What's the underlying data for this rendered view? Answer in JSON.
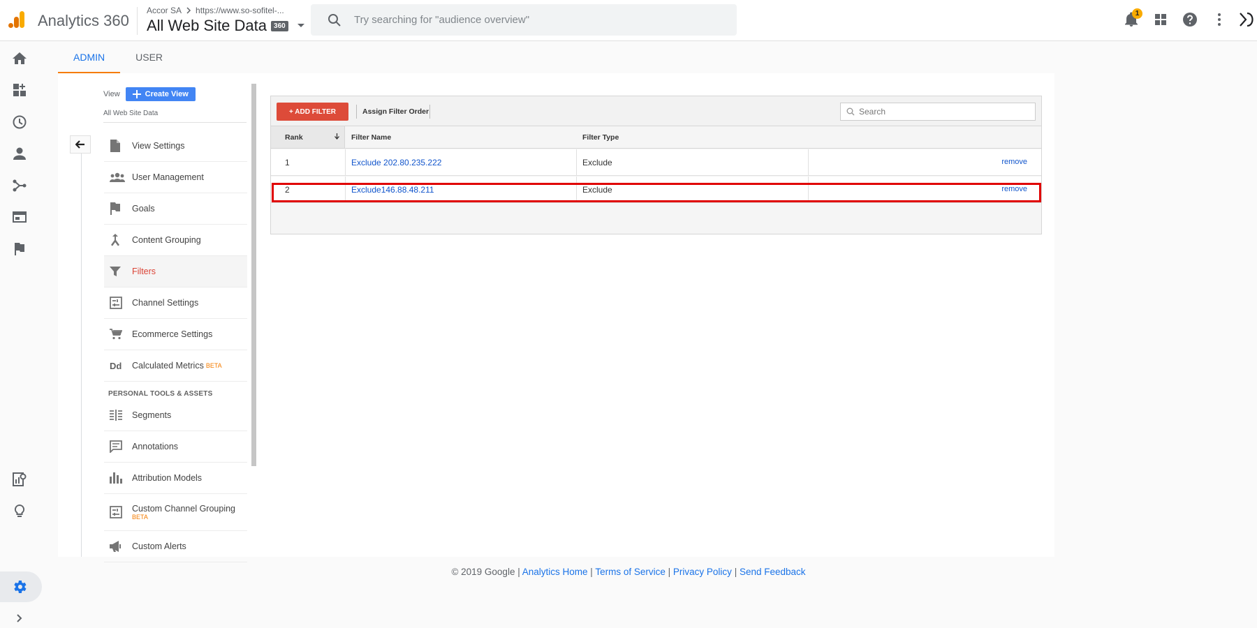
{
  "header": {
    "app_title": "Analytics 360",
    "account": "Accor SA",
    "property": "https://www.so-sofitel-...",
    "view_title": "All Web Site Data",
    "badge": "360",
    "search_placeholder": "Try searching for \"audience overview\"",
    "notification_count": "1"
  },
  "tabs": [
    {
      "label": "ADMIN",
      "active": true
    },
    {
      "label": "USER",
      "active": false
    }
  ],
  "view_column": {
    "label": "View",
    "create_button": "Create View",
    "current_view": "All Web Site Data",
    "menu": [
      {
        "label": "View Settings",
        "icon": "document-icon"
      },
      {
        "label": "User Management",
        "icon": "people-icon"
      },
      {
        "label": "Goals",
        "icon": "flag-icon"
      },
      {
        "label": "Content Grouping",
        "icon": "merge-icon"
      },
      {
        "label": "Filters",
        "icon": "funnel-icon",
        "active": true
      },
      {
        "label": "Channel Settings",
        "icon": "channel-icon"
      },
      {
        "label": "Ecommerce Settings",
        "icon": "cart-icon"
      },
      {
        "label": "Calculated Metrics",
        "icon": "dd-icon",
        "badge": "BETA"
      }
    ],
    "section_title": "PERSONAL TOOLS & ASSETS",
    "personal_menu": [
      {
        "label": "Segments",
        "icon": "segments-icon"
      },
      {
        "label": "Annotations",
        "icon": "annotation-icon"
      },
      {
        "label": "Attribution Models",
        "icon": "bar-chart-icon"
      },
      {
        "label": "Custom Channel Grouping",
        "icon": "channel-grouping-icon",
        "badge": "BETA"
      },
      {
        "label": "Custom Alerts",
        "icon": "megaphone-icon"
      }
    ]
  },
  "filters_table": {
    "add_button": "+ ADD FILTER",
    "assign_order": "Assign Filter Order",
    "search_placeholder": "Search",
    "columns": {
      "rank": "Rank",
      "name": "Filter Name",
      "type": "Filter Type"
    },
    "rows": [
      {
        "rank": "1",
        "name": "Exclude 202.80.235.222",
        "type": "Exclude",
        "action": "remove"
      },
      {
        "rank": "2",
        "name": "Exclude146.88.48.211",
        "type": "Exclude",
        "action": "remove"
      }
    ]
  },
  "footer": {
    "copyright": "© 2019 Google |",
    "links": [
      "Analytics Home",
      "Terms of Service",
      "Privacy Policy",
      "Send Feedback"
    ],
    "sep": "|"
  },
  "colors": {
    "accent_blue": "#1a73e8",
    "add_filter_red": "#dd4b39",
    "tab_underline": "#f57c00",
    "highlight_red": "#e00000"
  }
}
